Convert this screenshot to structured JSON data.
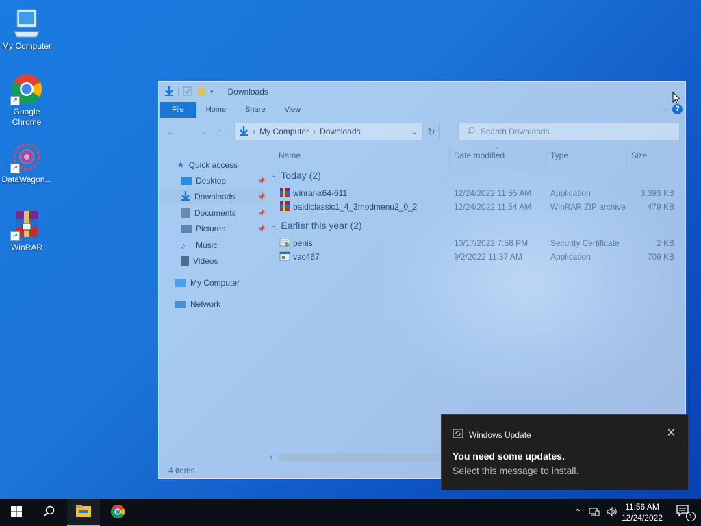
{
  "desktop": {
    "icons": [
      {
        "label": "My Computer",
        "icon": "computer-icon"
      },
      {
        "label": "Google\nChrome",
        "line1": "Google",
        "line2": "Chrome",
        "icon": "chrome-icon"
      },
      {
        "label": "DataWagon...",
        "icon": "datawagon-icon"
      },
      {
        "label": "WinRAR",
        "icon": "winrar-icon"
      }
    ]
  },
  "explorer": {
    "title": "Downloads",
    "ribbon": {
      "file": "File",
      "home": "Home",
      "share": "Share",
      "view": "View"
    },
    "address": {
      "root": "My Computer",
      "current": "Downloads"
    },
    "search_placeholder": "Search Downloads",
    "nav": {
      "quick_access": "Quick access",
      "desktop": "Desktop",
      "downloads": "Downloads",
      "documents": "Documents",
      "pictures": "Pictures",
      "music": "Music",
      "videos": "Videos",
      "my_computer": "My Computer",
      "network": "Network"
    },
    "columns": {
      "name": "Name",
      "date": "Date modified",
      "type": "Type",
      "size": "Size"
    },
    "groups": [
      {
        "label": "Today (2)",
        "files": [
          {
            "name": "winrar-x64-611",
            "date": "12/24/2022 11:55 AM",
            "type": "Application",
            "size": "3,393 KB",
            "icon": "winrar-installer-icon"
          },
          {
            "name": "baldiclassic1_4_3modmenu2_0_2",
            "date": "12/24/2022 11:54 AM",
            "type": "WinRAR ZIP archive",
            "size": "479 KB",
            "icon": "zip-archive-icon"
          }
        ]
      },
      {
        "label": "Earlier this year (2)",
        "files": [
          {
            "name": "penis",
            "date": "10/17/2022 7:58 PM",
            "type": "Security Certificate",
            "size": "2 KB",
            "icon": "certificate-icon"
          },
          {
            "name": "vac467",
            "date": "9/2/2022 11:37 AM",
            "type": "Application",
            "size": "709 KB",
            "icon": "application-icon"
          }
        ]
      }
    ],
    "status": "4 items"
  },
  "toast": {
    "app": "Windows Update",
    "title": "You need some updates.",
    "body": "Select this message to install."
  },
  "taskbar": {
    "time": "11:56 AM",
    "date": "12/24/2022",
    "notification_count": "1"
  },
  "colors": {
    "accent": "#1a78d4",
    "taskbar": "#0b0f17",
    "toast_bg": "#1f1f1f"
  }
}
